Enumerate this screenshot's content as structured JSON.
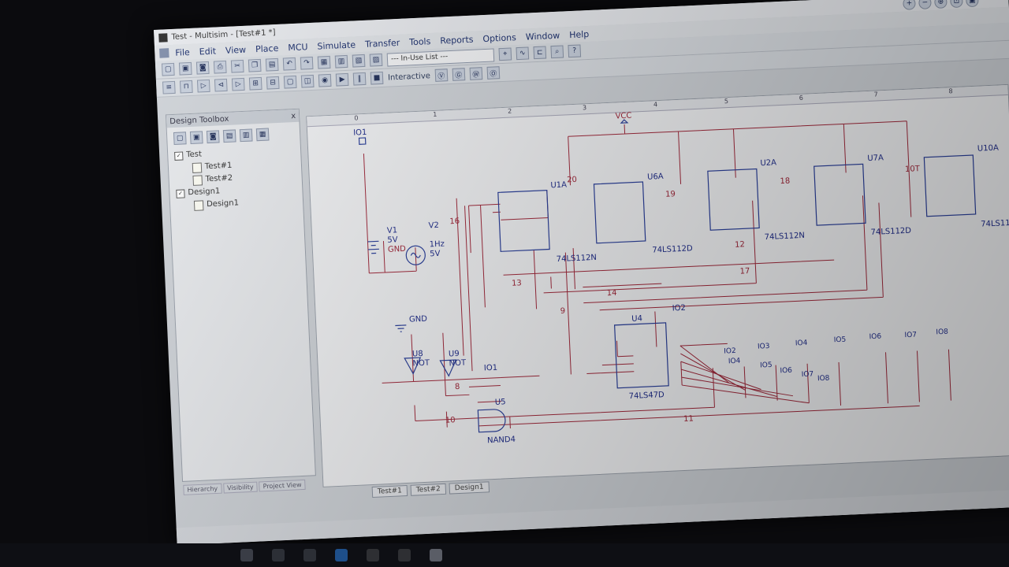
{
  "window": {
    "title": "Test - Multisim - [Test#1 *]"
  },
  "menu": [
    "File",
    "Edit",
    "View",
    "Place",
    "MCU",
    "Simulate",
    "Transfer",
    "Tools",
    "Reports",
    "Options",
    "Window",
    "Help"
  ],
  "toolbar": {
    "inuse_list": "--- In-Use List ---",
    "interactive": "Interactive"
  },
  "toolbox": {
    "title": "Design Toolbox",
    "close": "x",
    "tree": {
      "root": "Test",
      "item1": "Test#1",
      "item2": "Test#2",
      "design": "Design1",
      "design_child": "Design1"
    },
    "bottom_tabs": [
      "Hierarchy",
      "Visibility",
      "Project View"
    ]
  },
  "ruler": [
    "0",
    "1",
    "2",
    "3",
    "4",
    "5",
    "6",
    "7",
    "8"
  ],
  "sheet_tabs": [
    "Test#1",
    "Test#2",
    "Design1"
  ],
  "schematic": {
    "vcc": "VCC",
    "io1": "IO1",
    "io1b": "IO1",
    "io2": "IO2",
    "v1": {
      "name": "V1",
      "value": "5V",
      "gnd": "GND"
    },
    "v2": {
      "name": "V2",
      "freq": "1Hz",
      "amp": "5V"
    },
    "gnd": "GND",
    "u1a": {
      "ref": "U1A",
      "part": "74LS112N"
    },
    "u6a": {
      "ref": "U6A",
      "part": "74LS112D"
    },
    "u2a": {
      "ref": "U2A",
      "part": "74LS112N"
    },
    "u7a": {
      "ref": "U7A",
      "part": "74LS112D"
    },
    "u10a": {
      "ref": "U10A",
      "part": "74LS11"
    },
    "u4": {
      "ref": "U4",
      "part": "74LS47D"
    },
    "u8": {
      "ref": "U8",
      "part": "NOT"
    },
    "u9": {
      "ref": "U9",
      "part": "NOT"
    },
    "u5": {
      "ref": "U5",
      "part": "NAND4"
    },
    "nets": [
      "16",
      "20",
      "19",
      "18",
      "13",
      "12",
      "14",
      "17",
      "9",
      "8",
      "10",
      "11",
      "10T"
    ],
    "io_labels": [
      "IO2",
      "IO3",
      "IO4",
      "IO5",
      "IO6",
      "IO7",
      "IO8",
      "IO4",
      "IO5",
      "IO6",
      "IO7",
      "IO8"
    ]
  },
  "colors": {
    "wire": "#a0283a",
    "component": "#2a3f9a",
    "label": "#1f2c8a",
    "canvas": "#f0f1f3"
  }
}
